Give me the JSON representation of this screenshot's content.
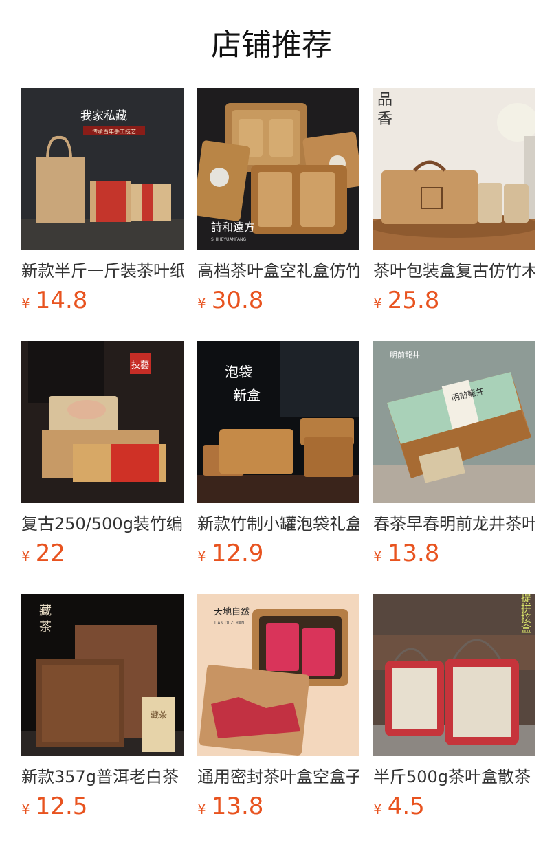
{
  "section_title": "店铺推荐",
  "currency": "¥",
  "products": [
    {
      "name": "新款半斤一斤装茶叶纸盒",
      "price": "14.8",
      "thumb_text": [
        "我家私藏",
        "传承百年手工技艺"
      ]
    },
    {
      "name": "高档茶叶盒空礼盒仿竹",
      "price": "30.8",
      "thumb_text": [
        "詩和遠方",
        "SHIHEYUANFANG"
      ]
    },
    {
      "name": "茶叶包装盒复古仿竹木",
      "price": "25.8",
      "thumb_text": [
        "品",
        "香"
      ]
    },
    {
      "name": "复古250/500g装竹编",
      "price": "22",
      "thumb_text": [
        "技藝"
      ]
    },
    {
      "name": "新款竹制小罐泡袋礼盒",
      "price": "12.9",
      "thumb_text": [
        "泡袋",
        "新盒"
      ]
    },
    {
      "name": "春茶早春明前龙井茶叶",
      "price": "13.8",
      "thumb_text": [
        "明前龍井",
        "明前龍井"
      ]
    },
    {
      "name": "新款357g普洱老白茶",
      "price": "12.5",
      "thumb_text": [
        "藏",
        "茶",
        "藏茶"
      ]
    },
    {
      "name": "通用密封茶叶盒空盒子",
      "price": "13.8",
      "thumb_text": [
        "天地自然",
        "TIAN DI ZI RAN"
      ]
    },
    {
      "name": "半斤500g茶叶盒散茶",
      "price": "4.5",
      "thumb_text": [
        "手提拼接盒"
      ]
    }
  ],
  "colors": {
    "price": "#e8531f",
    "name": "#333333",
    "title": "#111111"
  }
}
